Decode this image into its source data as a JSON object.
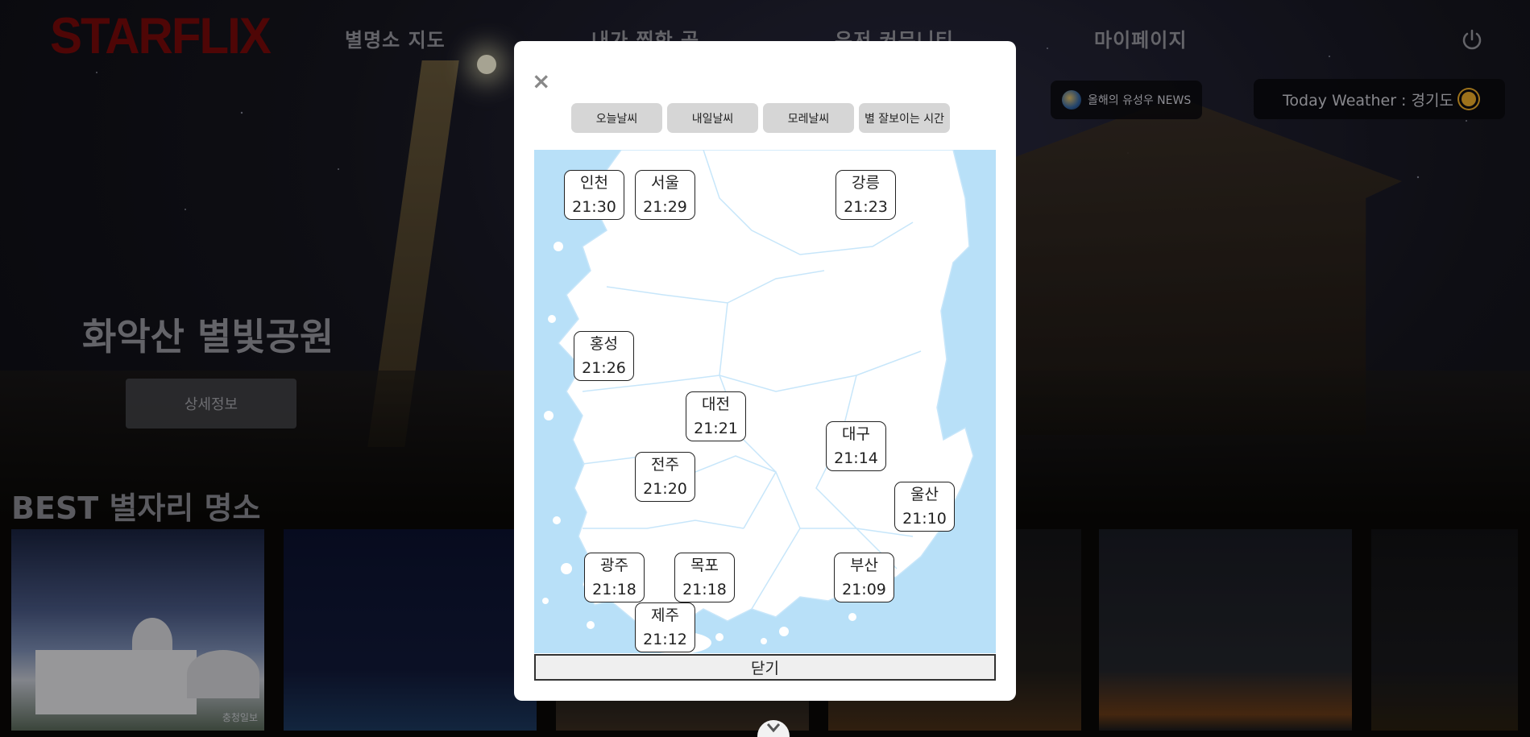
{
  "header": {
    "logo": "STARFLIX",
    "nav": [
      "별명소 지도",
      "내가 찜한 곳",
      "유저 커뮤니티",
      "마이페이지"
    ],
    "news_label": "올해의 유성우 NEWS",
    "weather_label": "Today Weather : 경기도"
  },
  "hero": {
    "title": "화악산 별빛공원",
    "detail_button": "상세정보"
  },
  "best": {
    "title": "BEST 별자리 명소",
    "card1_credit": "충청일보"
  },
  "scroll_icon": "chevron-down-icon",
  "modal": {
    "close_symbol": "×",
    "tabs": [
      "오늘날씨",
      "내일날씨",
      "모레날씨",
      "별 잘보이는 시간"
    ],
    "cities": [
      {
        "name": "인천",
        "time": "21:30"
      },
      {
        "name": "서울",
        "time": "21:29"
      },
      {
        "name": "강릉",
        "time": "21:23"
      },
      {
        "name": "홍성",
        "time": "21:26"
      },
      {
        "name": "대전",
        "time": "21:21"
      },
      {
        "name": "대구",
        "time": "21:14"
      },
      {
        "name": "전주",
        "time": "21:20"
      },
      {
        "name": "울산",
        "time": "21:10"
      },
      {
        "name": "광주",
        "time": "21:18"
      },
      {
        "name": "목포",
        "time": "21:18"
      },
      {
        "name": "부산",
        "time": "21:09"
      },
      {
        "name": "제주",
        "time": "21:12"
      }
    ],
    "close_button": "닫기"
  },
  "colors": {
    "sea": "#b8e0f8",
    "land": "#ffffff",
    "tab_bg": "#d6d6d6",
    "logo": "#7a0a0a"
  }
}
